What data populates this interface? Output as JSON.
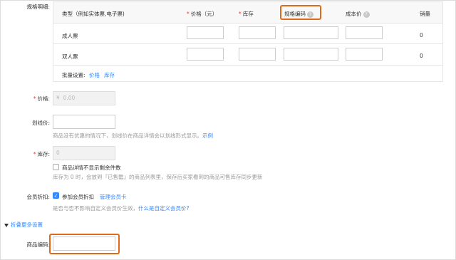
{
  "spec": {
    "label": "规格明细:",
    "headers": {
      "type": "类型（例如实体票,电子票)",
      "price": "价格（元）",
      "stock": "库存",
      "code": "规格编码",
      "cost": "成本价",
      "sales": "销量"
    },
    "rows": [
      {
        "name": "成人票",
        "sales": "0"
      },
      {
        "name": "双人票",
        "sales": "0"
      }
    ],
    "batch": {
      "label": "批量设置:",
      "price": "价格",
      "stock": "库存"
    }
  },
  "price": {
    "label": "价格:",
    "currency": "¥",
    "placeholder": "0.00"
  },
  "strike": {
    "label": "划线价:",
    "help": "商品没有优惠的情况下，划线价在商品详情会以划线形式显示。",
    "example": "示例"
  },
  "stock": {
    "label": "库存:",
    "value": "0",
    "checkbox_label": "商品详情不显示剩余件数",
    "help": "库存为 0 时，会放到『已售罄』的商品列表里，保存后买家看到的商品可售库存同步更新"
  },
  "member": {
    "label": "会员折扣:",
    "checkbox_label": "参加会员折扣",
    "card_link": "管理会员卡",
    "help": "是否与否不影响自定义会员价生效，",
    "help_link": "什么是自定义会员价?"
  },
  "more": {
    "label": "折叠更多设置"
  },
  "code": {
    "label": "商品编码:"
  },
  "colors": {
    "accent": "#3388ff",
    "highlight": "#e06a1b",
    "required": "#ee3333"
  }
}
